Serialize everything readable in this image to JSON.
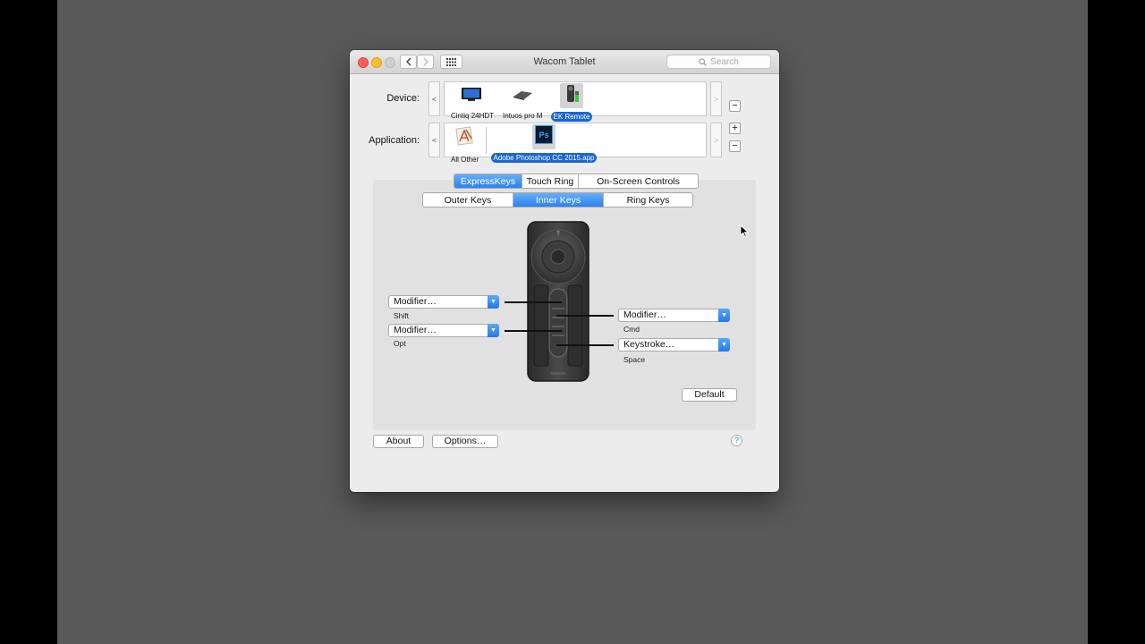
{
  "window": {
    "title": "Wacom Tablet"
  },
  "search": {
    "placeholder": "Search"
  },
  "device_row": {
    "label": "Device:",
    "prev": "<",
    "next": ">",
    "items": [
      {
        "label": "Cintiq 24HDT",
        "icon": "cintiq-display-icon",
        "selected": false
      },
      {
        "label": "Intuos pro M",
        "icon": "intuos-tablet-icon",
        "selected": false
      },
      {
        "label": "EK Remote",
        "icon": "expresskey-remote-icon",
        "selected": true
      }
    ],
    "remove": "−"
  },
  "application_row": {
    "label": "Application:",
    "prev": "<",
    "next": ">",
    "items": [
      {
        "label": "All Other",
        "icon": "all-other-apps-icon",
        "selected": false
      },
      {
        "label": "Adobe Photoshop CC 2015.app",
        "icon": "photoshop-icon",
        "icon_text": "Ps",
        "selected": true
      }
    ],
    "add": "+",
    "remove": "−"
  },
  "main_tabs": [
    {
      "label": "ExpressKeys",
      "active": true
    },
    {
      "label": "Touch Ring",
      "active": false
    },
    {
      "label": "On-Screen Controls",
      "active": false
    }
  ],
  "sub_tabs": [
    {
      "label": "Outer Keys",
      "active": false
    },
    {
      "label": "Inner Keys",
      "active": true
    },
    {
      "label": "Ring Keys",
      "active": false
    }
  ],
  "keys": {
    "left_top": {
      "value": "Modifier…",
      "sublabel": "Shift"
    },
    "left_bottom": {
      "value": "Modifier…",
      "sublabel": "Opt"
    },
    "right_top": {
      "value": "Modifier…",
      "sublabel": "Cmd"
    },
    "right_bottom": {
      "value": "Keystroke…",
      "sublabel": "Space"
    }
  },
  "remote_brand": "wacom",
  "buttons": {
    "default": "Default",
    "about": "About",
    "options": "Options…",
    "help": "?"
  },
  "colors": {
    "accent": "#2b82ee",
    "selection": "#1b66cf",
    "desktop": "#595959"
  }
}
